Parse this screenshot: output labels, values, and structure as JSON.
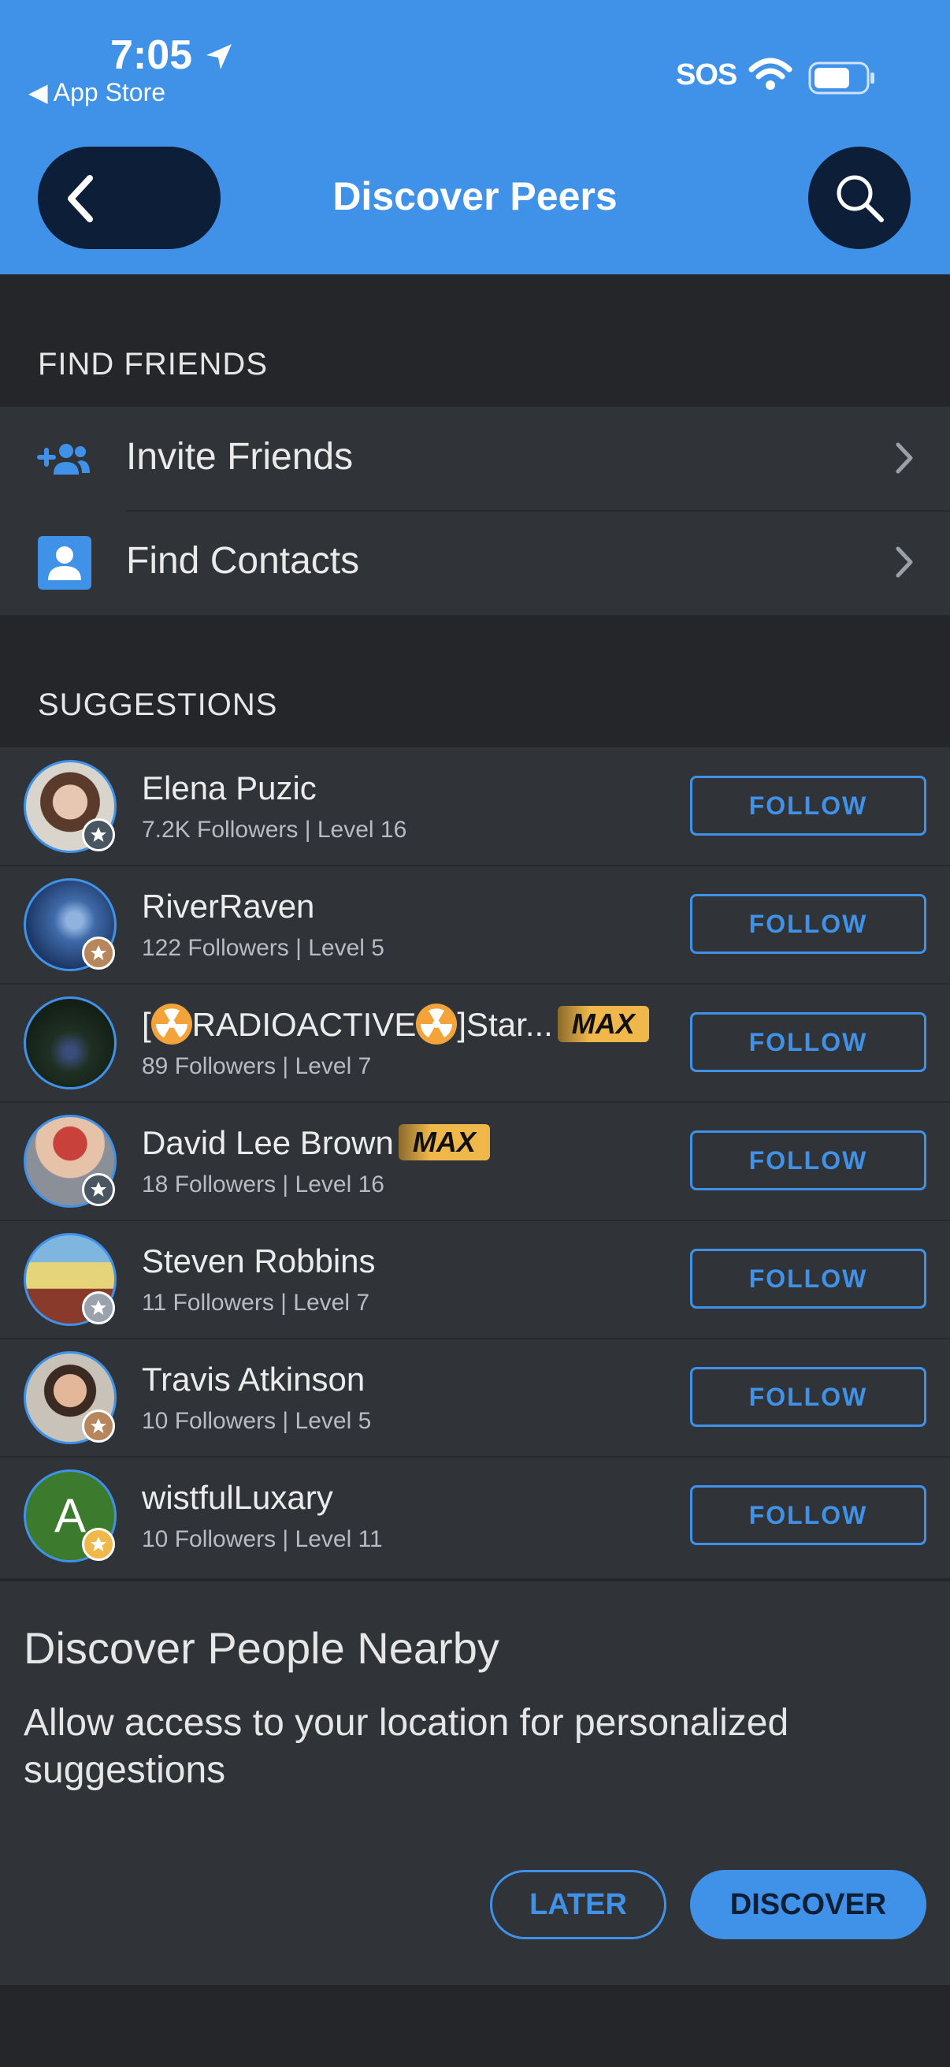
{
  "status_bar": {
    "time": "7:05",
    "back_app": "◀ App Store",
    "sos": "SOS"
  },
  "nav": {
    "title": "Discover Peers"
  },
  "find_friends": {
    "header": "FIND FRIENDS",
    "items": [
      {
        "label": "Invite Friends",
        "icon": "add-people-icon"
      },
      {
        "label": "Find Contacts",
        "icon": "contact-card-icon"
      }
    ]
  },
  "suggestions": {
    "header": "SUGGESTIONS",
    "follow_label": "FOLLOW",
    "max_label": "MAX",
    "users": [
      {
        "name": "Elena Puzic",
        "meta": "7.2K Followers | Level 16",
        "badge": "silver-star"
      },
      {
        "name": "RiverRaven",
        "meta": "122 Followers | Level 5",
        "badge": "bronze-star"
      },
      {
        "name_pre": "[",
        "name_mid": "RADIOACTIVE",
        "name_post": "]Star...",
        "meta": "89 Followers | Level 7",
        "max": true
      },
      {
        "name": "David Lee Brown",
        "meta": "18 Followers | Level 16",
        "badge": "silver-star",
        "max": true
      },
      {
        "name": "Steven Robbins",
        "meta": "11 Followers | Level 7",
        "badge": "silver-star"
      },
      {
        "name": "Travis Atkinson",
        "meta": "10 Followers | Level 5",
        "badge": "bronze-star"
      },
      {
        "name": "wistfulLuxary",
        "meta": "10 Followers | Level 11",
        "badge": "gold-star",
        "initial": "A"
      }
    ]
  },
  "nearby": {
    "title": "Discover People Nearby",
    "body": "Allow access to your location for personalized suggestions",
    "later": "LATER",
    "discover": "DISCOVER"
  },
  "colors": {
    "header_blue": "#3f92e8",
    "background": "#242629",
    "row_background": "#303439",
    "max_gold": "#f0b84a"
  }
}
